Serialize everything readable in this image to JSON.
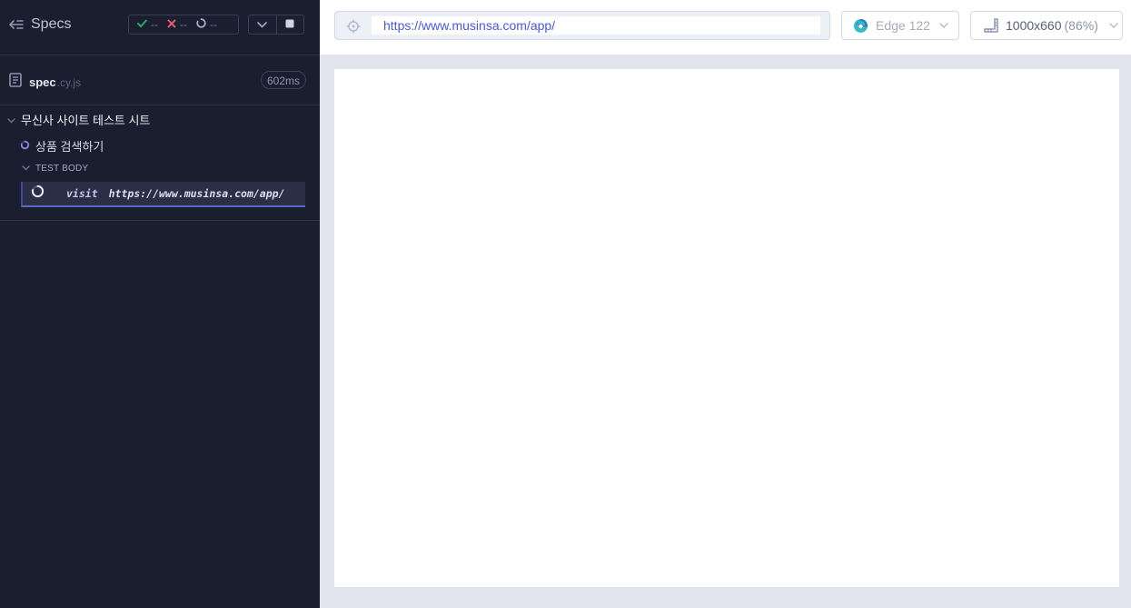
{
  "reporter": {
    "specs_label": "Specs",
    "stats": {
      "passed": "--",
      "failed": "--",
      "pending": "--"
    },
    "spec": {
      "name": "spec",
      "ext": ".cy.js",
      "duration": "602ms"
    },
    "suite": {
      "title": "무신사 사이트 테스트 시트",
      "test_title": "상품 검색하기",
      "body_label": "TEST BODY",
      "command": {
        "name": "visit",
        "message": "https://www.musinsa.com/app/"
      }
    }
  },
  "aut": {
    "url": "https://www.musinsa.com/app/",
    "browser": "Edge 122",
    "viewport": "1000x660",
    "zoom": "(86%)"
  },
  "colors": {
    "reporter_bg": "#1b1e2e",
    "passed": "#1fa971",
    "failed": "#e45770",
    "accent": "#4956e3",
    "command_border": "#5d67c8"
  },
  "icons": [
    "back-arrow-icon",
    "check-icon",
    "x-icon",
    "spinner-icon",
    "chevron-down-icon",
    "stop-icon",
    "document-icon",
    "crosshair-icon",
    "edge-browser-icon",
    "viewport-ruler-icon"
  ]
}
